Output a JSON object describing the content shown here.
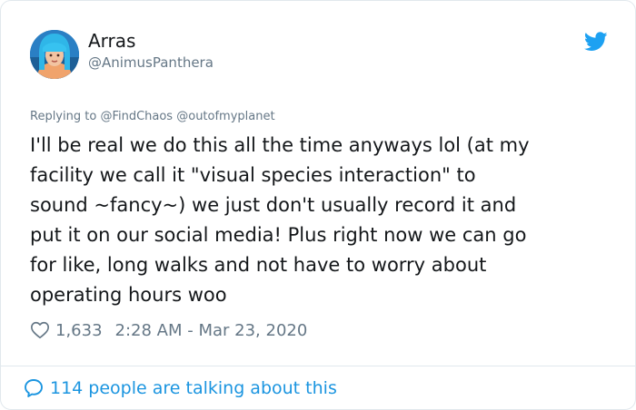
{
  "user": {
    "name": "Arras",
    "handle": "@AnimusPanthera"
  },
  "reply_context": {
    "prefix": "Replying to",
    "mentions": [
      "@FindChaos",
      "@outofmyplanet"
    ]
  },
  "tweet": {
    "lines": [
      "I'll be real we do this all the time anyways lol (at my",
      "facility we call it \"visual species interaction\" to",
      "sound ~fancy~) we just don't usually record it and",
      "put it on our social media! Plus right now we can go",
      "for like, long walks and not have to worry about",
      "operating hours woo"
    ]
  },
  "meta": {
    "likes": "1,633",
    "timestamp": "2:28 AM - Mar 23, 2020"
  },
  "footer": {
    "talking_label": "114 people are talking about this"
  },
  "icons": {
    "brand": "twitter-bird-icon",
    "like": "heart-icon",
    "conversation": "speech-bubble-icon"
  },
  "colors": {
    "brand_blue": "#1da1f2",
    "link_blue": "#1b95e0",
    "muted_gray": "#657786",
    "text": "#14171a",
    "border": "#e1e8ed"
  }
}
